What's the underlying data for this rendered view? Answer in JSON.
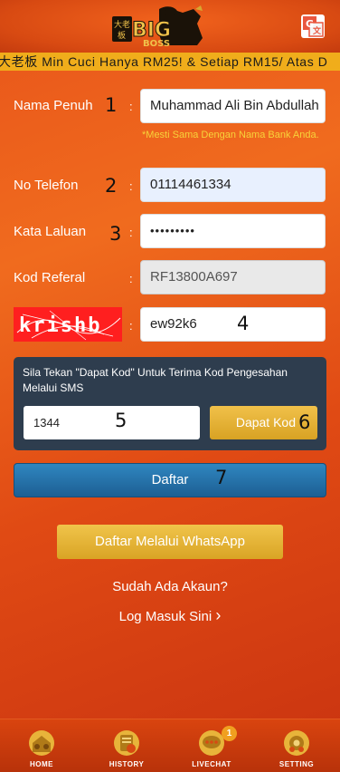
{
  "header": {
    "logo_alt": "大老板 BIG BOSS",
    "translate_icon": "translate-icon"
  },
  "marquee": {
    "text": "大老板 Min Cuci Hanya RM25! & Setiap RM15/ Atas D"
  },
  "form": {
    "full_name": {
      "label": "Nama Penuh",
      "marker": "1",
      "value": "Muhammad Ali Bin Abdullah",
      "hint": "*Mesti Sama Dengan Nama Bank Anda."
    },
    "phone": {
      "label": "No Telefon",
      "marker": "2",
      "value": "01114461334"
    },
    "password": {
      "label": "Kata Laluan",
      "marker": "3",
      "value": "•••••••••"
    },
    "referral": {
      "label": "Kod Referal",
      "value": "RF13800A697"
    },
    "captcha": {
      "image_text": "krishb",
      "value": "ew92k6",
      "marker": "4"
    },
    "colon": ":"
  },
  "sms": {
    "instruction": "Sila Tekan \"Dapat Kod\" Untuk Terima Kod Pengesahan Melalui SMS",
    "code_value": "1344",
    "code_marker": "5",
    "button_label": "Dapat Kod",
    "button_marker": "6"
  },
  "actions": {
    "register_label": "Daftar",
    "register_marker": "7",
    "whatsapp_label": "Daftar Melalui WhatsApp",
    "have_account": "Sudah Ada Akaun?",
    "login_link": "Log Masuk Sini",
    "login_chevron": "›"
  },
  "nav": {
    "items": [
      {
        "label": "HOME",
        "icon": "home-icon"
      },
      {
        "label": "HISTORY",
        "icon": "history-icon"
      },
      {
        "label": "LIVECHAT",
        "icon": "livechat-icon",
        "badge": "1"
      },
      {
        "label": "SETTING",
        "icon": "setting-icon"
      }
    ]
  },
  "colors": {
    "background": "#e8541a",
    "marquee": "#f0ad1b",
    "primary_button": "#2f86c0",
    "gold_button": "#e0ad2f",
    "hint": "#f7d33a",
    "sms_panel": "#2e3d4e"
  }
}
